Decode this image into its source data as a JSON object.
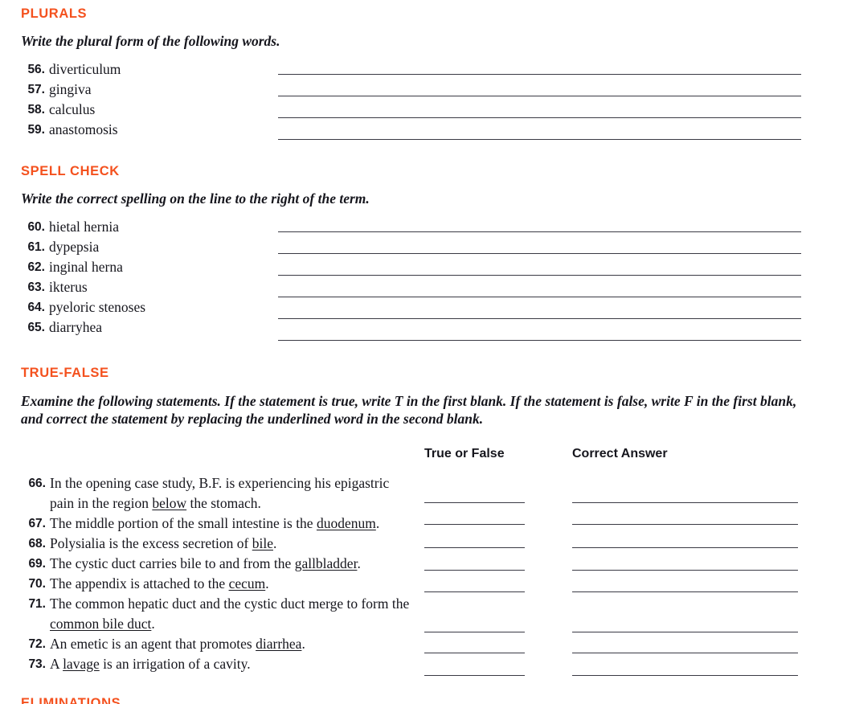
{
  "theme": {
    "accent": "#f4511e",
    "text": "#16161d",
    "rule": "#3a3a44",
    "background": "#ffffff"
  },
  "sections": {
    "plurals": {
      "heading": "PLURALS",
      "instruction": "Write the plural form of the following words.",
      "items": [
        {
          "number": "56.",
          "term": "diverticulum"
        },
        {
          "number": "57.",
          "term": "gingiva"
        },
        {
          "number": "58.",
          "term": "calculus"
        },
        {
          "number": "59.",
          "term": "anastomosis"
        }
      ]
    },
    "spell_check": {
      "heading": "SPELL CHECK",
      "instruction": "Write the correct spelling on the line to the right of the term.",
      "items": [
        {
          "number": "60.",
          "term": "hietal hernia"
        },
        {
          "number": "61.",
          "term": "dypepsia"
        },
        {
          "number": "62.",
          "term": "inginal herna"
        },
        {
          "number": "63.",
          "term": "ikterus"
        },
        {
          "number": "64.",
          "term": "pyeloric stenoses"
        },
        {
          "number": "65.",
          "term": "diarryhea"
        }
      ]
    },
    "true_false": {
      "heading": "TRUE-FALSE",
      "instruction": "Examine the following statements. If the statement is true, write T in the first blank. If the statement is false, write F in the first blank, and correct the statement by replacing the underlined word in the second blank.",
      "column_headers": {
        "true_or_false": "True or False",
        "correct_answer": "Correct Answer"
      },
      "items": [
        {
          "number": "66.",
          "before": "In the opening case study, B.F. is experiencing his epigastric pain in the region ",
          "underlined": "below",
          "after": " the stomach."
        },
        {
          "number": "67.",
          "before": "The middle portion of the small intestine is the ",
          "underlined": "duodenum",
          "after": "."
        },
        {
          "number": "68.",
          "before": "Polysialia is the excess secretion of ",
          "underlined": "bile",
          "after": "."
        },
        {
          "number": "69.",
          "before": "The cystic duct carries bile to and from the ",
          "underlined": "gallbladder",
          "after": "."
        },
        {
          "number": "70.",
          "before": "The appendix is attached to the ",
          "underlined": "cecum",
          "after": "."
        },
        {
          "number": "71.",
          "before": "The common hepatic duct and the cystic duct merge to form the ",
          "underlined": "common bile duct",
          "after": "."
        },
        {
          "number": "72.",
          "before": "An emetic is an agent that promotes ",
          "underlined": "diarrhea",
          "after": "."
        },
        {
          "number": "73.",
          "before": "A ",
          "underlined": "lavage",
          "after": " is an irrigation of a cavity."
        }
      ]
    },
    "next_section": {
      "heading": "ELIMINATIONS"
    }
  }
}
